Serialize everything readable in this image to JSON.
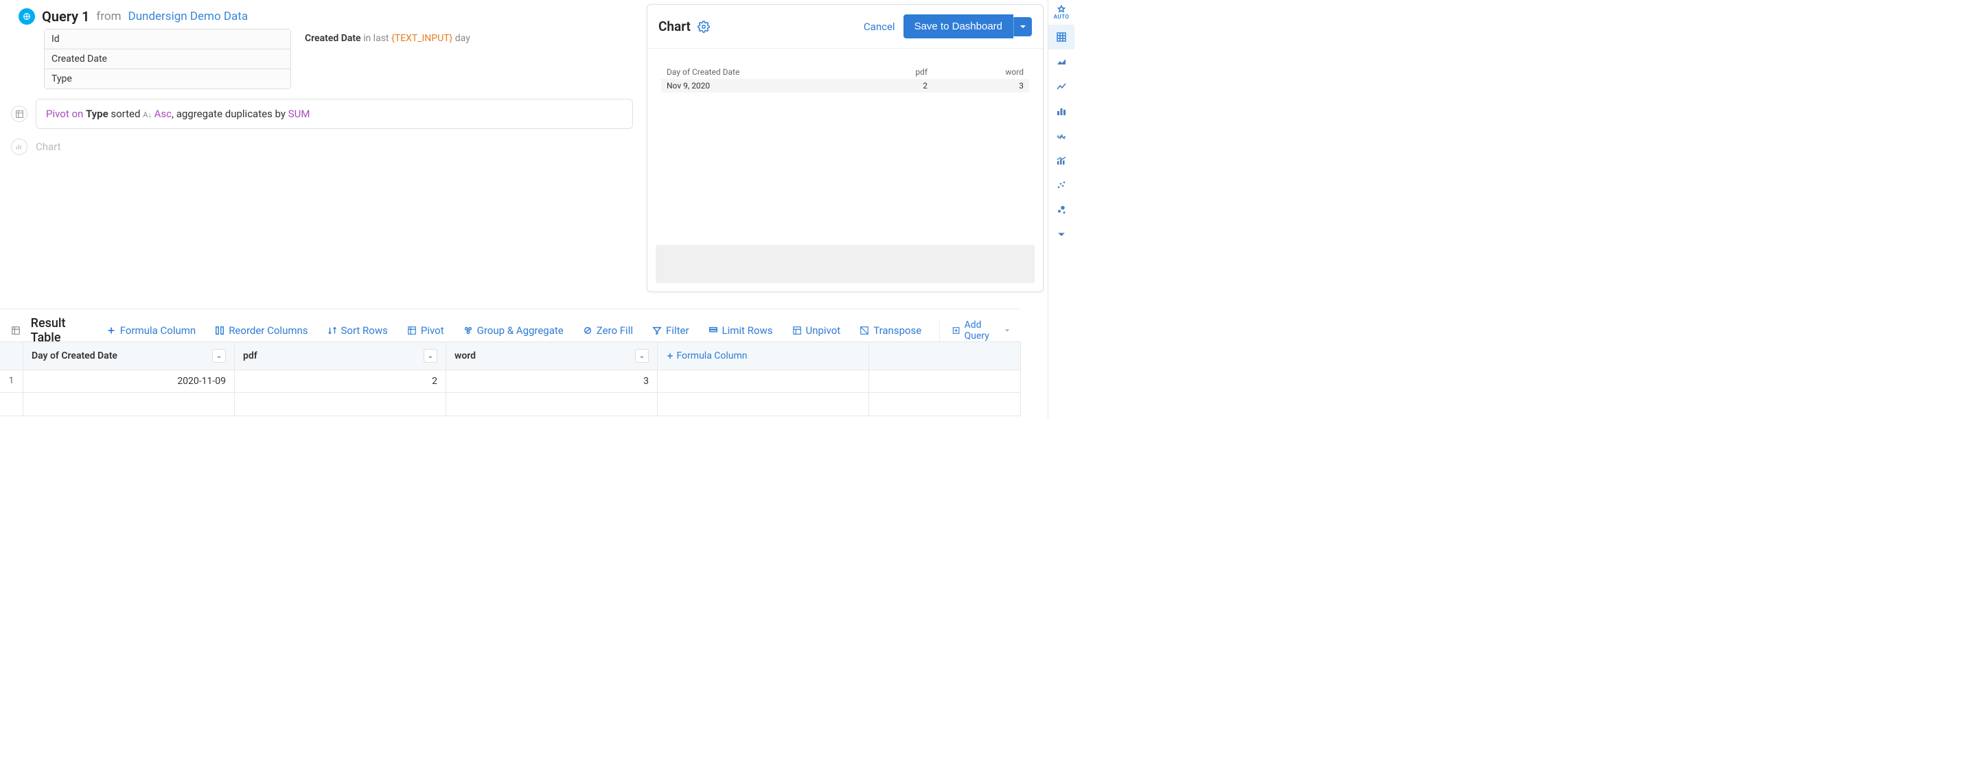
{
  "query": {
    "title": "Query 1",
    "from_word": "from",
    "source": "Dundersign Demo Data",
    "columns": [
      "Id",
      "Created Date",
      "Type"
    ],
    "filter": {
      "field": "Created Date",
      "op": "in last",
      "param": "{TEXT_INPUT}",
      "unit": "day"
    }
  },
  "pivot_step": {
    "prefix": "Pivot on",
    "field": "Type",
    "sorted_word": "sorted",
    "dir": "Asc",
    "agg_prefix": ", aggregate duplicates by",
    "agg": "SUM"
  },
  "chart_step": {
    "label": "Chart"
  },
  "chart_panel": {
    "title": "Chart",
    "cancel": "Cancel",
    "save": "Save to Dashboard",
    "columns": [
      "Day of Created Date",
      "pdf",
      "word"
    ],
    "rows": [
      {
        "date": "Nov 9, 2020",
        "pdf": "2",
        "word": "3"
      }
    ]
  },
  "results": {
    "title": "Result Table",
    "tools": {
      "formula": "Formula Column",
      "reorder": "Reorder Columns",
      "sort": "Sort Rows",
      "pivot": "Pivot",
      "group": "Group & Aggregate",
      "zero": "Zero Fill",
      "filter": "Filter",
      "limit": "Limit Rows",
      "unpivot": "Unpivot",
      "transpose": "Transpose"
    },
    "add_query": "Add Query"
  },
  "result_table": {
    "headers": {
      "c1": "Day of Created Date",
      "c2": "pdf",
      "c3": "word",
      "c4": "Formula Column"
    },
    "row1": {
      "num": "1",
      "c1": "2020-11-09",
      "c2": "2",
      "c3": "3"
    }
  },
  "sidebar": {
    "auto": "AUTO"
  },
  "chart_data": {
    "type": "table",
    "columns": [
      "Day of Created Date",
      "pdf",
      "word"
    ],
    "rows": [
      [
        "Nov 9, 2020",
        2,
        3
      ]
    ]
  }
}
